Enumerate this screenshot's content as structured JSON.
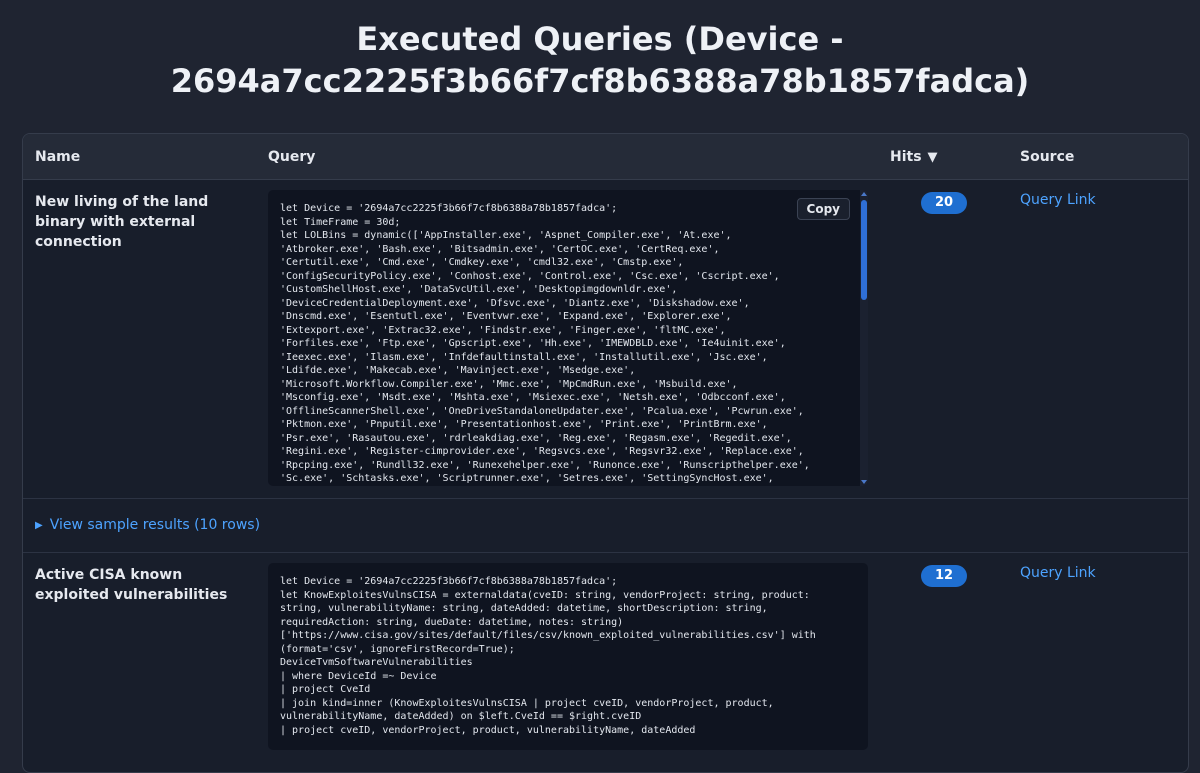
{
  "page": {
    "title_line1": "Executed Queries (Device -",
    "title_line2": "2694a7cc2225f3b66f7cf8b6388a78b1857fadca)"
  },
  "table": {
    "headers": {
      "name": "Name",
      "query": "Query",
      "hits": "Hits",
      "hits_sort_icon": "▼",
      "source": "Source"
    },
    "copy_label": "Copy",
    "rows": [
      {
        "name": "New living of the land binary with external connection",
        "query": "let Device = '2694a7cc2225f3b66f7cf8b6388a78b1857fadca';\nlet TimeFrame = 30d;\nlet LOLBins = dynamic(['AppInstaller.exe', 'Aspnet_Compiler.exe', 'At.exe',\n'Atbroker.exe', 'Bash.exe', 'Bitsadmin.exe', 'CertOC.exe', 'CertReq.exe',\n'Certutil.exe', 'Cmd.exe', 'Cmdkey.exe', 'cmdl32.exe', 'Cmstp.exe',\n'ConfigSecurityPolicy.exe', 'Conhost.exe', 'Control.exe', 'Csc.exe', 'Cscript.exe',\n'CustomShellHost.exe', 'DataSvcUtil.exe', 'Desktopimgdownldr.exe',\n'DeviceCredentialDeployment.exe', 'Dfsvc.exe', 'Diantz.exe', 'Diskshadow.exe',\n'Dnscmd.exe', 'Esentutl.exe', 'Eventvwr.exe', 'Expand.exe', 'Explorer.exe',\n'Extexport.exe', 'Extrac32.exe', 'Findstr.exe', 'Finger.exe', 'fltMC.exe',\n'Forfiles.exe', 'Ftp.exe', 'Gpscript.exe', 'Hh.exe', 'IMEWDBLD.exe', 'Ie4uinit.exe',\n'Ieexec.exe', 'Ilasm.exe', 'Infdefaultinstall.exe', 'Installutil.exe', 'Jsc.exe',\n'Ldifde.exe', 'Makecab.exe', 'Mavinject.exe', 'Msedge.exe',\n'Microsoft.Workflow.Compiler.exe', 'Mmc.exe', 'MpCmdRun.exe', 'Msbuild.exe',\n'Msconfig.exe', 'Msdt.exe', 'Mshta.exe', 'Msiexec.exe', 'Netsh.exe', 'Odbcconf.exe',\n'OfflineScannerShell.exe', 'OneDriveStandaloneUpdater.exe', 'Pcalua.exe', 'Pcwrun.exe',\n'Pktmon.exe', 'Pnputil.exe', 'Presentationhost.exe', 'Print.exe', 'PrintBrm.exe',\n'Psr.exe', 'Rasautou.exe', 'rdrleakdiag.exe', 'Reg.exe', 'Regasm.exe', 'Regedit.exe',\n'Regini.exe', 'Register-cimprovider.exe', 'Regsvcs.exe', 'Regsvr32.exe', 'Replace.exe',\n'Rpcping.exe', 'Rundll32.exe', 'Runexehelper.exe', 'Runonce.exe', 'Runscripthelper.exe',\n'Sc.exe', 'Schtasks.exe', 'Scriptrunner.exe', 'Setres.exe', 'SettingSyncHost.exe',",
        "hits": "20",
        "source_label": "Query Link"
      },
      {
        "name": "Active CISA known exploited vulnerabilities",
        "query": "let Device = '2694a7cc2225f3b66f7cf8b6388a78b1857fadca';\nlet KnowExploitesVulnsCISA = externaldata(cveID: string, vendorProject: string, product:\nstring, vulnerabilityName: string, dateAdded: datetime, shortDescription: string,\nrequiredAction: string, dueDate: datetime, notes: string)\n['https://www.cisa.gov/sites/default/files/csv/known_exploited_vulnerabilities.csv'] with\n(format='csv', ignoreFirstRecord=True);\nDeviceTvmSoftwareVulnerabilities\n| where DeviceId =~ Device\n| project CveId\n| join kind=inner (KnowExploitesVulnsCISA | project cveID, vendorProject, product,\nvulnerabilityName, dateAdded) on $left.CveId == $right.cveID\n| project cveID, vendorProject, product, vulnerabilityName, dateAdded",
        "hits": "12",
        "source_label": "Query Link"
      }
    ],
    "sample_results_label": "View sample results (10 rows)",
    "sample_toggle_icon": "▶"
  },
  "colors": {
    "background": "#1f2431",
    "panel": "#181e2b",
    "code_background": "#0f1420",
    "accent": "#1f6fd1",
    "link": "#4da3ff"
  }
}
